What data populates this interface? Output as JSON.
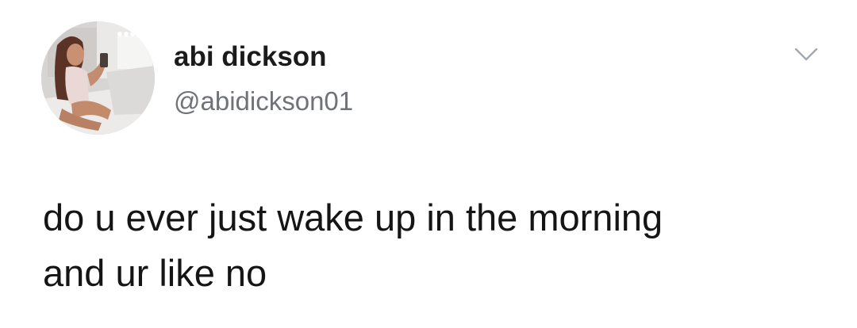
{
  "tweet": {
    "user": {
      "display_name": "abi dickson",
      "handle": "@abidickson01",
      "avatar_icon": "profile-photo"
    },
    "menu_icon": "chevron-down-icon",
    "text": "do u ever just wake up in the morning\nand ur like no"
  },
  "colors": {
    "background": "#ffffff",
    "name": "#1b1b1b",
    "handle": "#6f7378",
    "body_text": "#151515",
    "caret": "#a3a9b0"
  }
}
